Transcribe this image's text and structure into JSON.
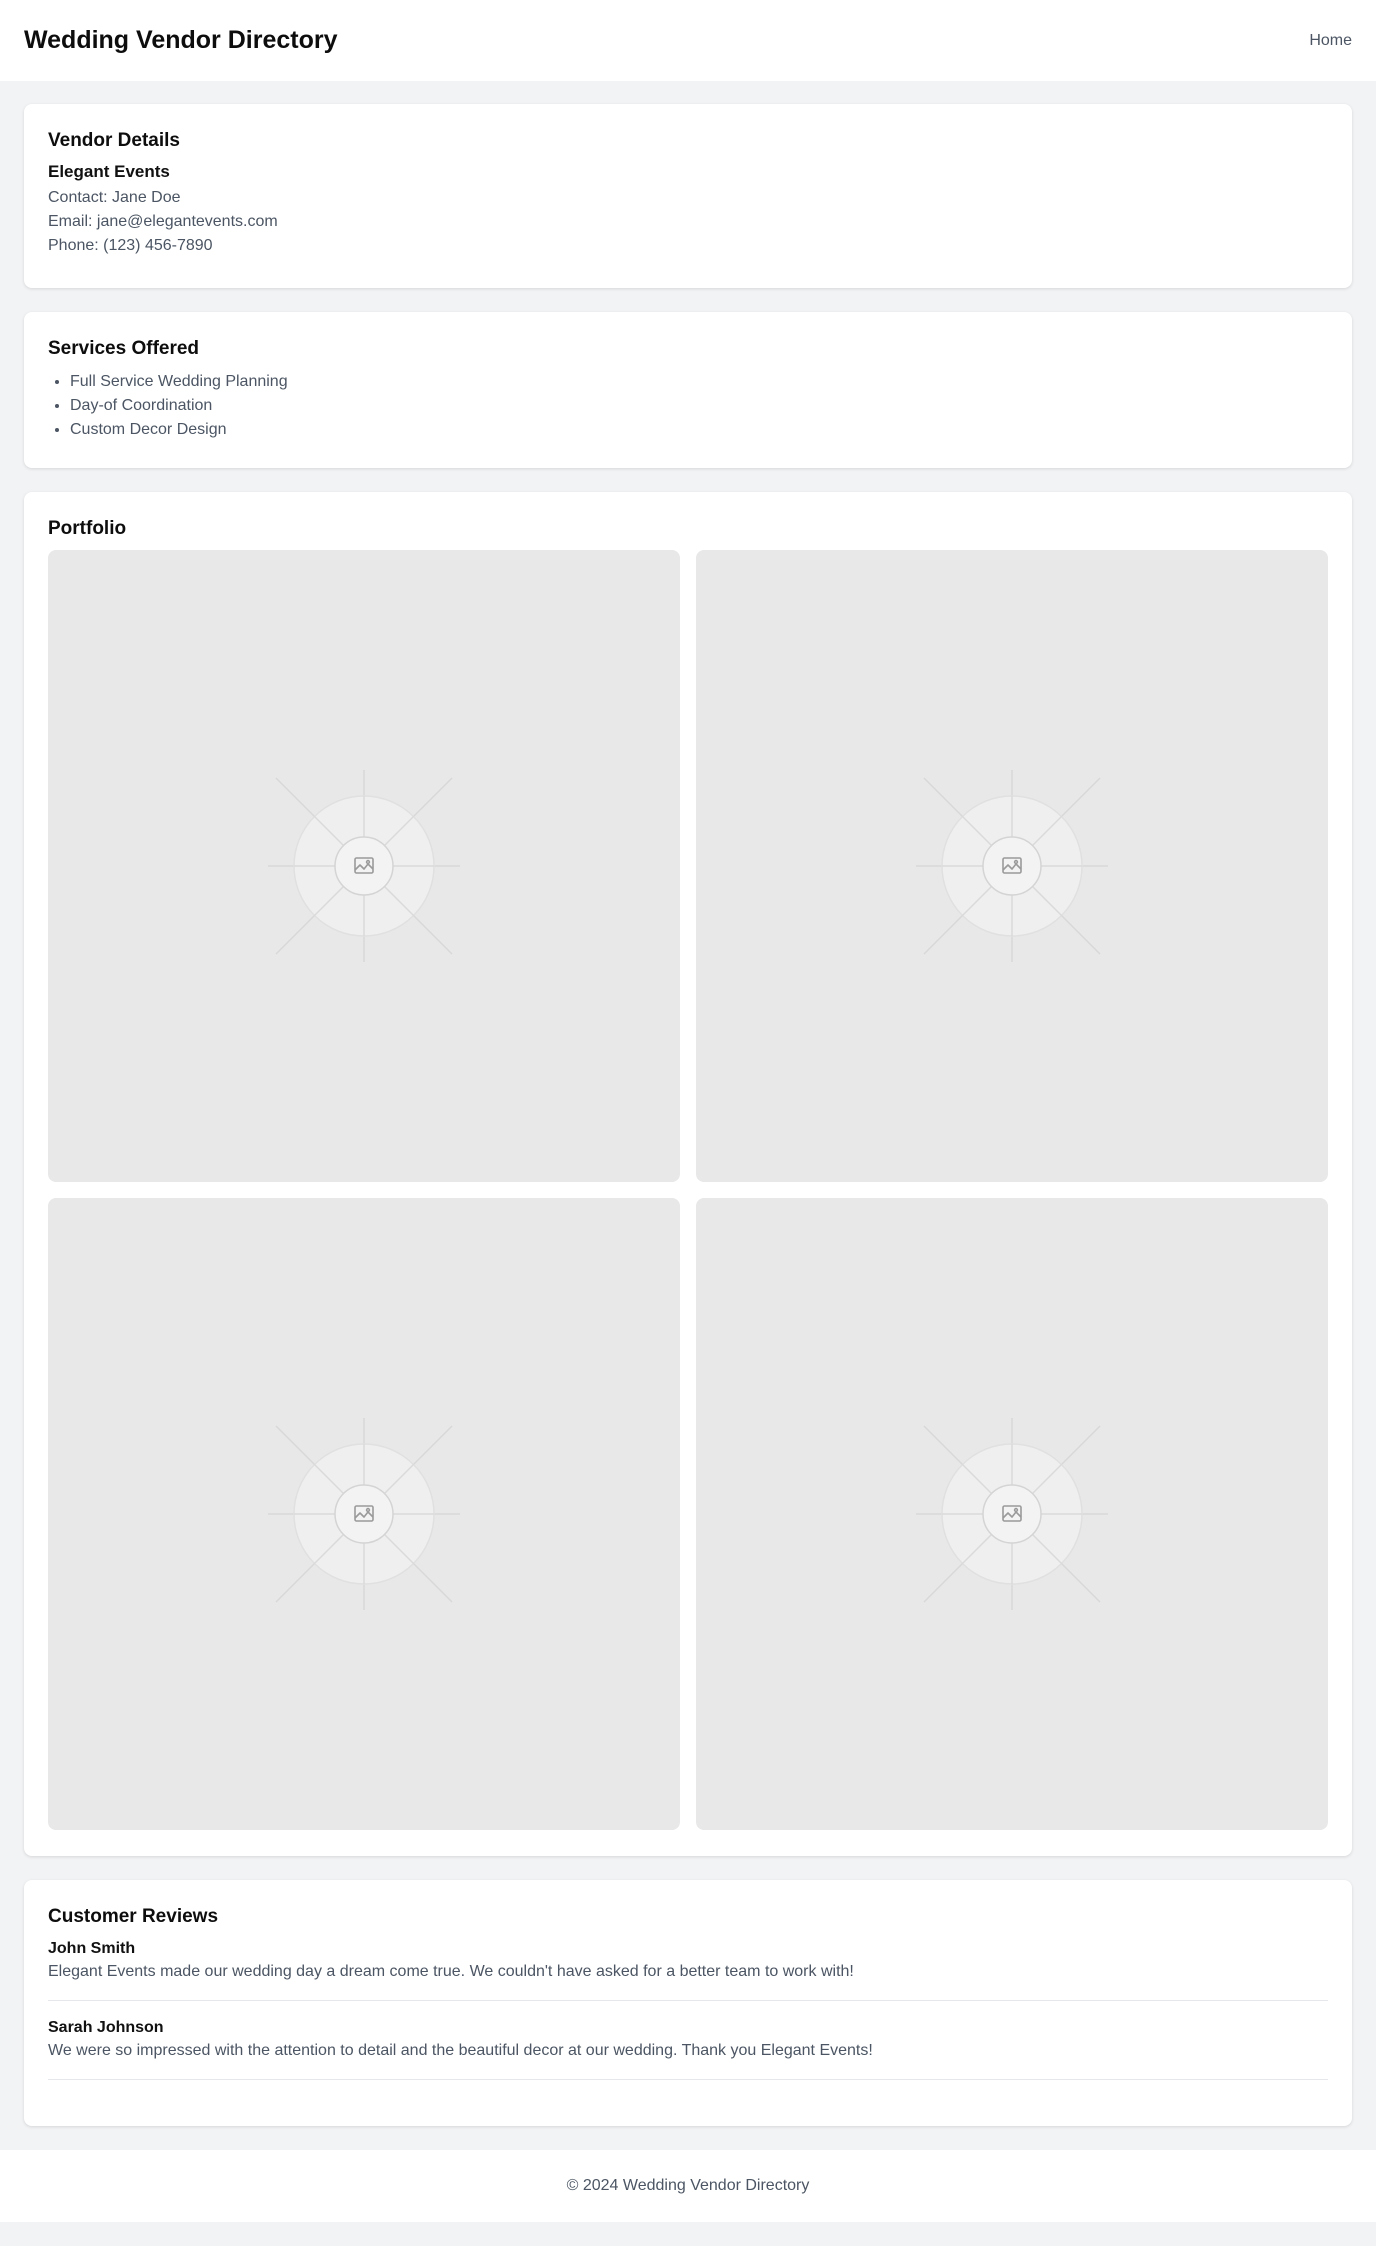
{
  "header": {
    "title": "Wedding Vendor Directory",
    "nav_home": "Home"
  },
  "vendor": {
    "section_title": "Vendor Details",
    "name": "Elegant Events",
    "contact": "Contact: Jane Doe",
    "email": "Email: jane@elegantevents.com",
    "phone": "Phone: (123) 456-7890"
  },
  "services": {
    "section_title": "Services Offered",
    "items": [
      "Full Service Wedding Planning",
      "Day-of Coordination",
      "Custom Decor Design"
    ]
  },
  "portfolio": {
    "section_title": "Portfolio",
    "image_count": 4,
    "placeholder_icon": "image-placeholder-icon"
  },
  "reviews": {
    "section_title": "Customer Reviews",
    "items": [
      {
        "name": "John Smith",
        "text": "Elegant Events made our wedding day a dream come true. We couldn't have asked for a better team to work with!"
      },
      {
        "name": "Sarah Johnson",
        "text": "We were so impressed with the attention to detail and the beautiful decor at our wedding. Thank you Elegant Events!"
      }
    ]
  },
  "footer": {
    "copyright": "© 2024 Wedding Vendor Directory"
  },
  "colors": {
    "page_background": "#f2f3f5",
    "card_background": "#ffffff",
    "muted_text": "#4b5563",
    "placeholder_gray": "#e8e8e8"
  }
}
